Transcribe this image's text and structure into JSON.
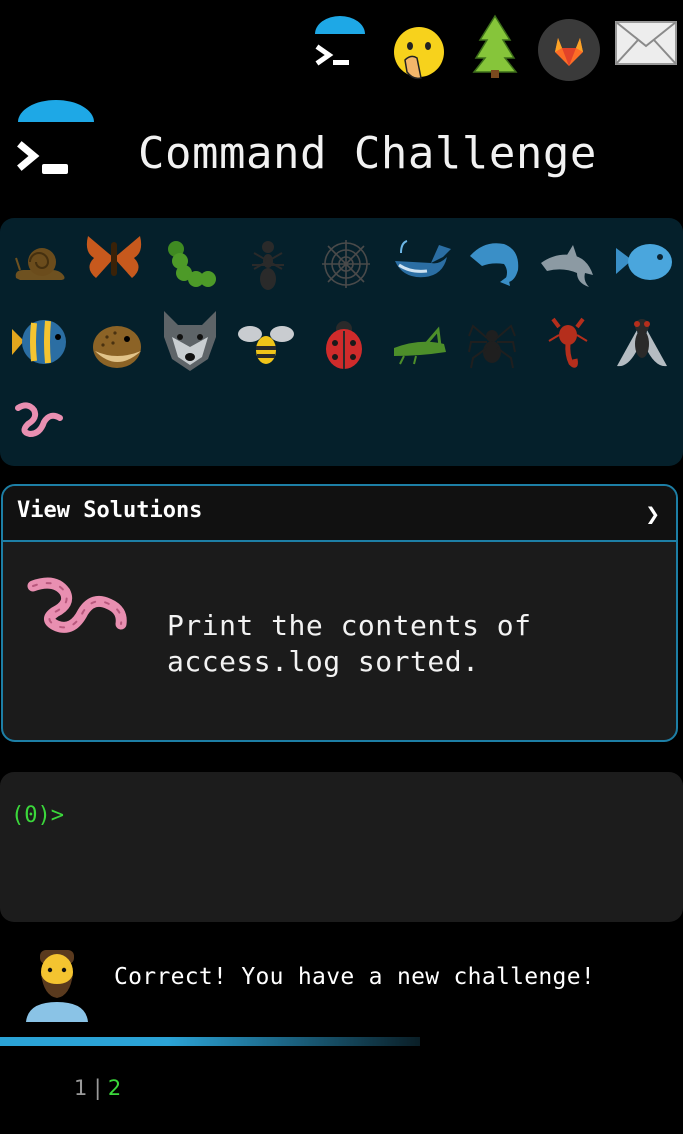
{
  "app": {
    "title": "Command Challenge"
  },
  "nav": {
    "items": [
      {
        "name": "terminal-icon"
      },
      {
        "name": "hushed-face-icon"
      },
      {
        "name": "tree-icon"
      },
      {
        "name": "gitlab-icon"
      },
      {
        "name": "mail-icon"
      }
    ]
  },
  "creatures": [
    "snail",
    "butterfly",
    "caterpillar",
    "ant",
    "spider-web",
    "whale",
    "dolphin",
    "dolphin-gray",
    "fish",
    "tropical-fish",
    "blowfish",
    "wolf",
    "bee",
    "ladybug",
    "cricket",
    "spider",
    "scorpion",
    "fly",
    "worm"
  ],
  "challenge": {
    "solutions_label": "View Solutions",
    "chevron": "❯",
    "task": "Print the contents of access.log sorted."
  },
  "terminal": {
    "prompt": "(0)>"
  },
  "status": {
    "message": "Correct! You have a new challenge!"
  },
  "pager": {
    "prev": "1",
    "separator": "|",
    "current": "2"
  },
  "colors": {
    "accent": "#1d7fa6",
    "prompt": "#3bd83b",
    "grid_bg": "#05202b"
  }
}
